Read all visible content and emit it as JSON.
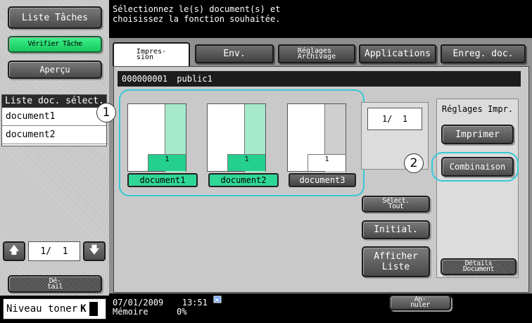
{
  "left": {
    "task_list_label": "Liste Tâches",
    "verify_task_label": "Vérifier Tâche",
    "preview_label": "Aperçu",
    "selected_docs_header": "Liste doc. sélect.",
    "selected_docs": [
      "document1",
      "document2"
    ],
    "pager_text": "1/  1",
    "detail_label": "Dé-\ntail",
    "toner_label": "Niveau toner",
    "toner_color": "K"
  },
  "header": {
    "instruction_line1": "Sélectionnez le(s) document(s) et",
    "instruction_line2": "choisissez la fonction souhaitée."
  },
  "tabs": [
    {
      "label": "Impres-\nsion",
      "active": true
    },
    {
      "label": "Env.",
      "active": false
    },
    {
      "label": "Réglages\nArchivage",
      "active": false
    },
    {
      "label": "Applications",
      "active": false
    },
    {
      "label": "Enreg. doc.",
      "active": false
    }
  ],
  "box": {
    "id": "000000001",
    "name": "public1"
  },
  "documents": [
    {
      "name": "document1",
      "page_count": "1",
      "selected": true
    },
    {
      "name": "document2",
      "page_count": "1",
      "selected": true
    },
    {
      "name": "document3",
      "page_count": "1",
      "selected": false
    }
  ],
  "page_counter": "1/  1",
  "actions": {
    "select_all_label": "Sélect.\nTout",
    "initial_label": "Initial.",
    "show_list_label": "Afficher\nListe"
  },
  "settings": {
    "title": "Réglages Impr.",
    "print_label": "Imprimer",
    "combine_label": "Combinaison",
    "doc_details_label": "Détails\nDocument"
  },
  "callouts": [
    "1",
    "2"
  ],
  "footer": {
    "date": "07/01/2009",
    "time": "13:51",
    "memory_label": "Mémoire",
    "memory_value": "0%",
    "cancel_label": "An-\nnuler"
  },
  "colors": {
    "selected_green": "#2fd797",
    "highlight_cyan": "#37c9d4",
    "bright_green": "#22e06a"
  }
}
